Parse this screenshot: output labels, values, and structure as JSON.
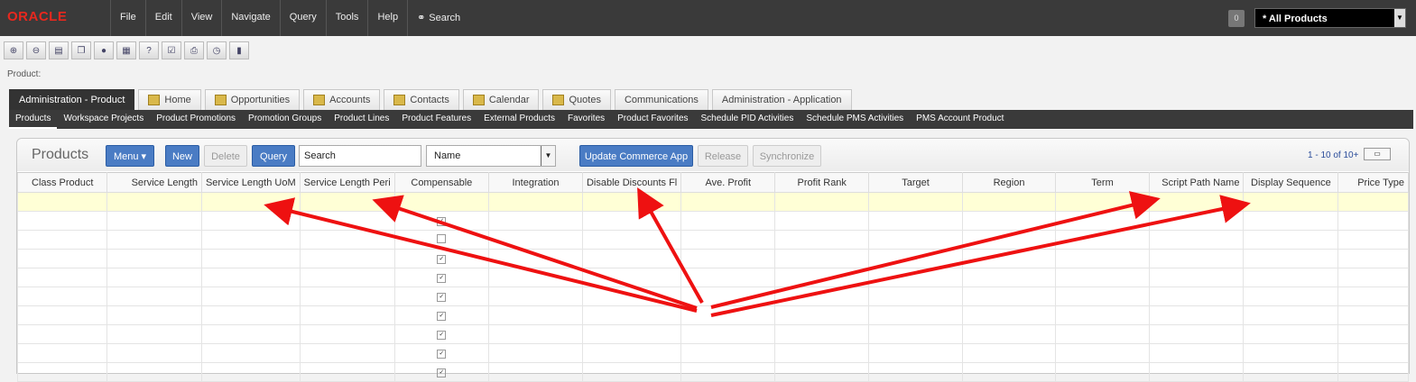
{
  "app": {
    "logo": "ORACLE"
  },
  "menu": [
    "File",
    "Edit",
    "View",
    "Navigate",
    "Query",
    "Tools",
    "Help"
  ],
  "menu_search": "Search",
  "badge": "0",
  "product_selector": "* All Products",
  "toolbar_icons": [
    "zoom-in-icon",
    "zoom-out-icon",
    "new-record-icon",
    "copy-record-icon",
    "globe-icon",
    "keyboard-icon",
    "help-icon",
    "checklist-icon",
    "print-icon",
    "clock-icon",
    "chart-icon"
  ],
  "breadcrumb": "Product:",
  "tabs": [
    {
      "label": "Administration - Product",
      "active": true
    },
    {
      "label": "Home"
    },
    {
      "label": "Opportunities"
    },
    {
      "label": "Accounts"
    },
    {
      "label": "Contacts"
    },
    {
      "label": "Calendar"
    },
    {
      "label": "Quotes"
    },
    {
      "label": "Communications"
    },
    {
      "label": "Administration - Application"
    }
  ],
  "subnav": [
    "Products",
    "Workspace Projects",
    "Product Promotions",
    "Promotion Groups",
    "Product Lines",
    "Product Features",
    "External Products",
    "Favorites",
    "Product Favorites",
    "Schedule PID Activities",
    "Schedule PMS Activities",
    "PMS Account Product"
  ],
  "panel": {
    "title": "Products",
    "menu_btn": "Menu",
    "new_btn": "New",
    "delete_btn": "Delete",
    "query_btn": "Query",
    "search_value": "Search",
    "field_select": "Name",
    "update_btn": "Update Commerce App",
    "release_btn": "Release",
    "sync_btn": "Synchronize",
    "pagination": "1 - 10 of 10+"
  },
  "columns": [
    "Class Product",
    "Service Length",
    "Service Length UoM",
    "Service Length Peri",
    "Compensable",
    "Integration",
    "Disable Discounts Fl",
    "Ave. Profit",
    "Profit Rank",
    "Target",
    "Region",
    "Term",
    "Script Path Name",
    "Display Sequence",
    "Price Type"
  ],
  "rows_compensable_checked": [
    true,
    false,
    true,
    true,
    true,
    true,
    true,
    true,
    true
  ],
  "colors": {
    "annotation_arrow": "#ee1111",
    "accent": "#4a7cc4",
    "selected_row": "#ffffd6"
  }
}
